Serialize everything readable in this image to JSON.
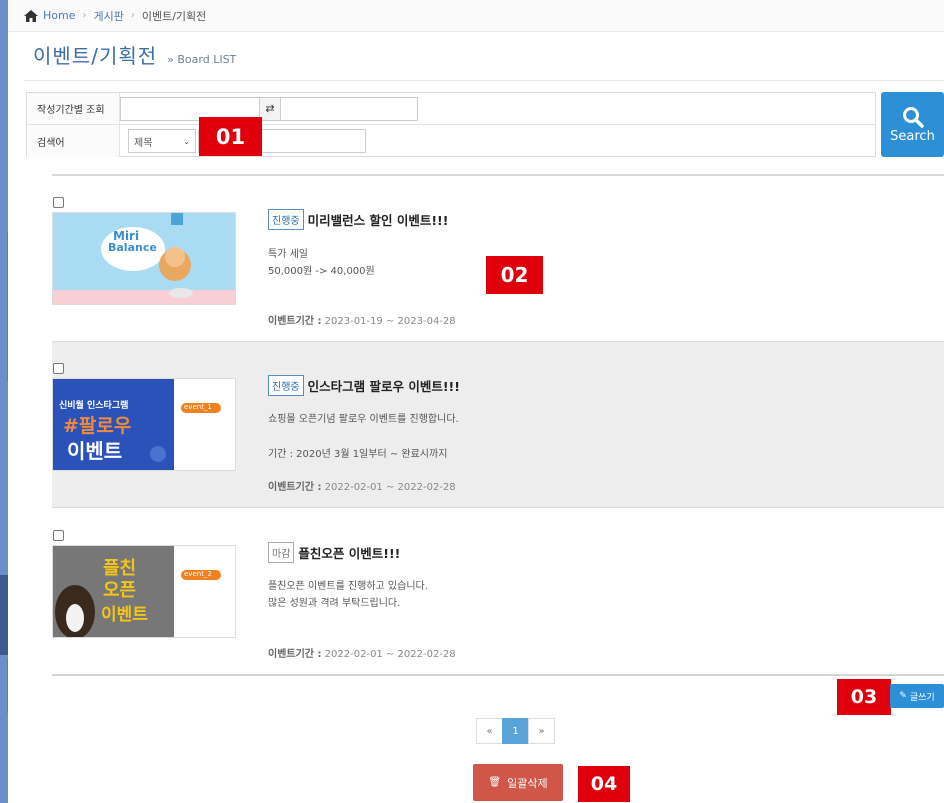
{
  "breadcrumb": {
    "home": "Home",
    "board": "게시판",
    "current": "이벤트/기획전"
  },
  "header": {
    "title": "이벤트/기획전",
    "subtitle": "» Board LIST"
  },
  "search": {
    "period_label": "작성기간별 조회",
    "keyword_label": "검색어",
    "field_selected": "제목",
    "button_label": "Search"
  },
  "badges": {
    "b01": "01",
    "b02": "02",
    "b03": "03",
    "b04": "04"
  },
  "items": [
    {
      "status": "진행중",
      "title": "미리밸런스 할인 이벤트!!!",
      "desc1": "특가 세일",
      "desc2": "50,000원 -> 40,000원",
      "period_label": "이벤트기간 :",
      "period": "2023-01-19 ~ 2023-04-28",
      "thumb": {
        "brand1": "Miri",
        "brand2": "Balance"
      }
    },
    {
      "status": "진행중",
      "title": "인스타그램 팔로우 이벤트!!!",
      "desc1": "쇼핑몰 오픈기념 팔로우 이벤트를 진행합니다.",
      "desc2": "기간 : 2020년 3월 1일부터 ~ 완료시까지",
      "period_label": "이벤트기간 :",
      "period": "2022-02-01 ~ 2022-02-28",
      "thumb": {
        "line1": "신비월 인스타그램",
        "line2": "#팔로우",
        "line3": "이벤트",
        "tag": "event_1"
      }
    },
    {
      "status": "마감",
      "title": "플친오픈 이벤트!!!",
      "desc1": "플친오픈 이벤트를 진행하고 있습니다.",
      "desc2": "많은 성원과 격려 부탁드립니다.",
      "period_label": "이벤트기간 :",
      "period": "2022-02-01 ~ 2022-02-28",
      "thumb": {
        "line1": "플친",
        "line2": "오픈",
        "line3": "이벤트",
        "tag": "event_2"
      }
    }
  ],
  "actions": {
    "write": "글쓰기",
    "delete_all": "일괄삭제"
  },
  "pagination": {
    "prev": "«",
    "current": "1",
    "next": "»"
  },
  "colors": {
    "primary": "#2d8fd6",
    "title": "#3c6ea7",
    "danger": "#d1564a",
    "badge": "#e0000b"
  }
}
